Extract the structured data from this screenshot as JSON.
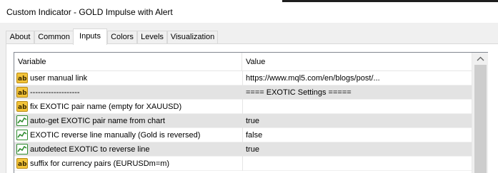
{
  "window": {
    "title": "Custom Indicator - GOLD Impulse with Alert"
  },
  "tabs": [
    {
      "label": "About",
      "active": false
    },
    {
      "label": "Common",
      "active": false
    },
    {
      "label": "Inputs",
      "active": true
    },
    {
      "label": "Colors",
      "active": false
    },
    {
      "label": "Levels",
      "active": false
    },
    {
      "label": "Visualization",
      "active": false
    }
  ],
  "grid": {
    "columns": {
      "variable": "Variable",
      "value": "Value"
    },
    "rows": [
      {
        "icon": "ab-string-icon",
        "variable": "user manual link",
        "value": "https://www.mql5.com/en/blogs/post/...",
        "shaded": false
      },
      {
        "icon": "ab-string-icon",
        "variable": "-------------------",
        "value": "==== EXOTIC Settings =====",
        "shaded": true
      },
      {
        "icon": "ab-string-icon",
        "variable": "fix EXOTIC pair name (empty for XAUUSD)",
        "value": "",
        "shaded": false
      },
      {
        "icon": "bool-chart-icon",
        "variable": "auto-get EXOTIC pair name from chart",
        "value": "true",
        "shaded": true
      },
      {
        "icon": "bool-chart-icon",
        "variable": "EXOTIC reverse line manually (Gold is reversed)",
        "value": "false",
        "shaded": false
      },
      {
        "icon": "bool-chart-icon",
        "variable": "autodetect EXOTIC to reverse line",
        "value": "true",
        "shaded": true
      },
      {
        "icon": "ab-string-icon",
        "variable": "suffix for currency pairs (EURUSDm=m)",
        "value": "",
        "shaded": false
      }
    ]
  },
  "colors": {
    "ab_icon": "#f3c43a",
    "bool_icon_bg": "#ffffff",
    "bool_icon_line": "#2e8b2e",
    "row_shade": "#e3e3e3",
    "grid_border": "#828790",
    "scroll_thumb": "#cdcdcd"
  }
}
